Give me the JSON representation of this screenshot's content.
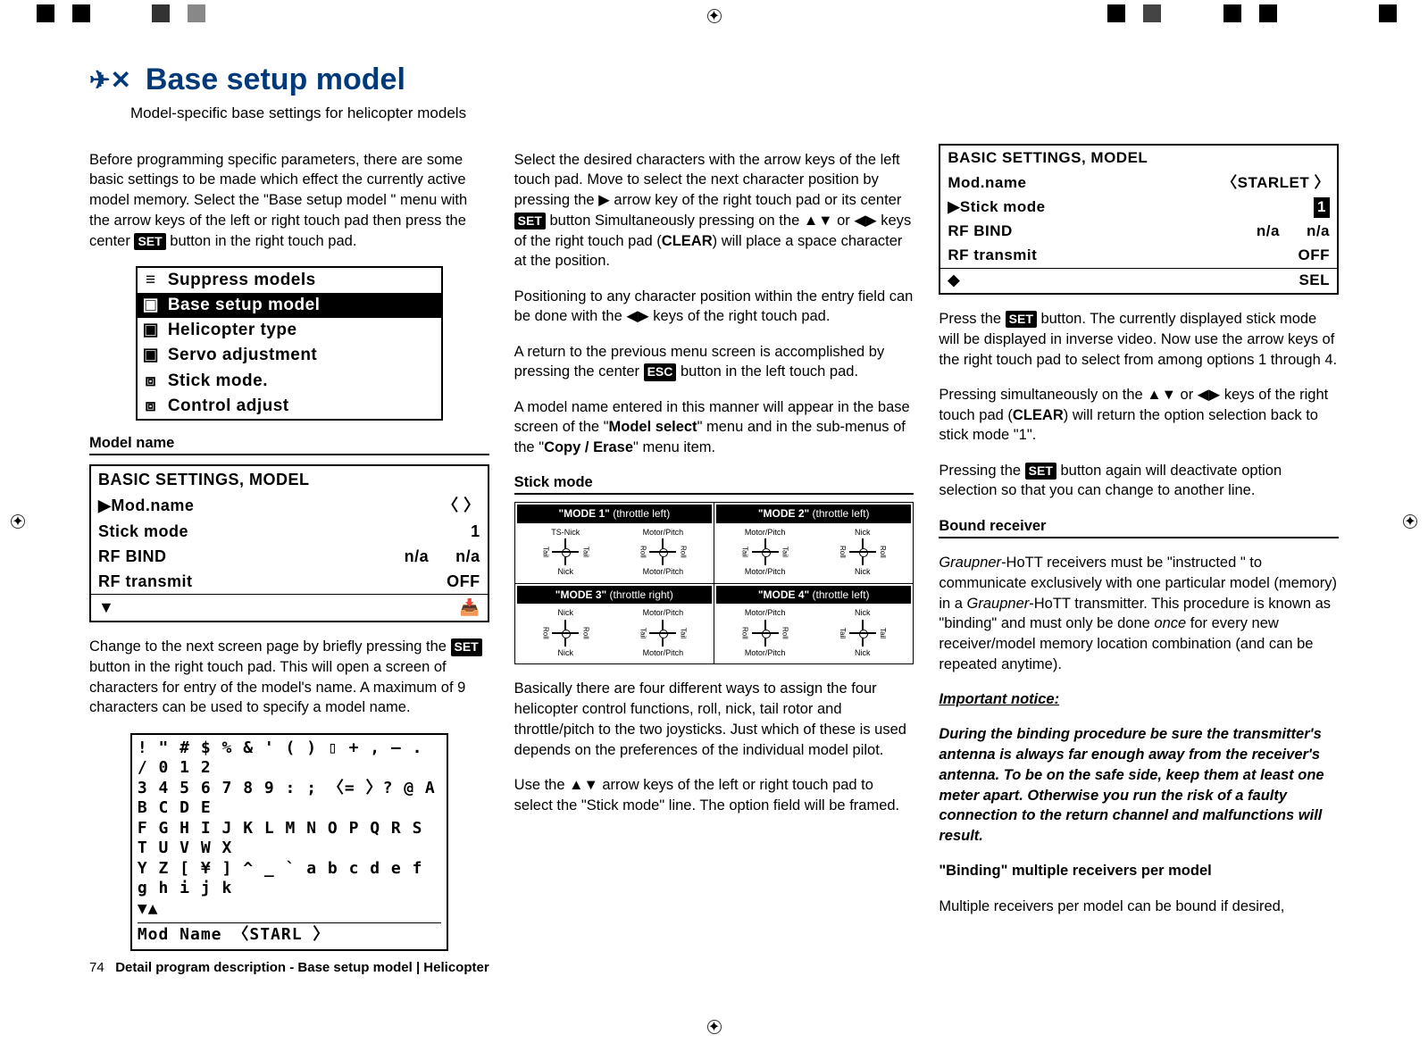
{
  "header": {
    "title": "Base setup model",
    "subtitle": "Model-specific base settings for helicopter models"
  },
  "col1": {
    "p1a": "Before programming specific parameters, there are some basic settings to be made which effect the currently active model memory. Select the \"Base setup model \" menu with the arrow keys of the left or right touch pad then press the center ",
    "p1b": " button in the right touch pad.",
    "menu": {
      "i1": "Suppress models",
      "i2": "Base setup model",
      "i3": "Helicopter type",
      "i4": "Servo adjustment",
      "i5": "Stick mode.",
      "i6": "Control adjust"
    },
    "sect1": "Model name",
    "screen1": {
      "hdr": "BASIC  SETTINGS,  MODEL",
      "r1": "▶Mod.name",
      "r1v": "〈                  〉",
      "r2": "  Stick mode",
      "r2v": "1",
      "r3": "  RF BIND",
      "r3a": "n/a",
      "r3b": "n/a",
      "r4": "  RF transmit",
      "r4v": "OFF",
      "foot": "▼",
      "footicon": "📥"
    },
    "p2a": "Change to the next screen page by briefly pressing the ",
    "p2b": " button in the right touch pad. This will open a screen of characters for entry of the model's name. A maximum of 9 characters can be used to specify a model name.",
    "chars": {
      "l1": " ! \" # $ % & ' ( ) ▯ + , – . / 0 1 2",
      "l2": "3 4 5 6 7 8 9 : ; 〈= 〉? @ A B C D E",
      "l3": "F G H I J K L M N O P Q R S T U V W X",
      "l4": "Y Z [ ¥ ] ^ _ ` a b c d e f g h i j k",
      "l5": "▼▲",
      "ftr": "Mod  Name 〈STARL          〉"
    }
  },
  "col2": {
    "p1a": "Select the desired characters with the arrow keys of the left touch pad. Move to select the next character position by pressing the ▶ arrow key of the right touch pad or its center ",
    "p1b": " button Simultaneously pressing on the ▲▼ or ◀▶ keys of the right touch pad (",
    "p1c": ") will place a space character at the position.",
    "clear": "CLEAR",
    "p2": "Positioning to any character position within the entry field can be done with the ◀▶ keys of the right touch pad.",
    "p3a": "A return to the previous menu screen is accomplished by pressing the center ",
    "p3b": " button in the left touch pad.",
    "p4a": "A model name entered in this manner will appear in the base screen of the \"",
    "p4m": "Model select",
    "p4b": "\" menu and in the sub-menus of the \"",
    "p4n": "Copy / Erase",
    "p4c": "\" menu item.",
    "sect2": "Stick mode",
    "modes": {
      "m1": "\"MODE 1\"",
      "m1t": " (throttle left)",
      "m2": "\"MODE 2\"",
      "m2t": " (throttle left)",
      "m3": "\"MODE 3\"",
      "m3t": " (throttle right)",
      "m4": "\"MODE 4\"",
      "m4t": " (throttle left)",
      "tsnick": "TS-Nick",
      "nick": "Nick",
      "mp": "Motor/Pitch",
      "roll": "Roll",
      "tail": "Tail"
    },
    "p5": "Basically there are four different ways to assign the four helicopter control functions, roll, nick, tail rotor and throttle/pitch to the two joysticks. Just which of these is used depends on the preferences of the individual model pilot.",
    "p6": "Use the ▲▼ arrow keys of the left or right touch pad to select the \"Stick mode\" line. The option field will be framed."
  },
  "col3": {
    "screen2": {
      "hdr": "BASIC  SETTINGS,  MODEL",
      "r1": "  Mod.name",
      "r1v": "〈STARLET   〉",
      "r2": "▶Stick mode",
      "r2v": "1",
      "r3": "  RF BIND",
      "r3a": "n/a",
      "r3b": "n/a",
      "r4": "  RF transmit",
      "r4v": "OFF",
      "foot": "◆",
      "footv": "SEL"
    },
    "p1a": "Press the ",
    "p1b": " button. The currently displayed stick mode will be displayed in inverse video. Now use the arrow keys of the right touch pad to select from among options 1 through 4.",
    "p2a": "Pressing simultaneously on the ▲▼ or ◀▶ keys of the right touch pad (",
    "p2b": ") will return the option selection back to stick mode \"1\".",
    "clear": "CLEAR",
    "p3a": "Pressing the ",
    "p3b": " button again will deactivate option selection so that you can change to another line.",
    "sect3": "Bound receiver",
    "p4a": "Graupner",
    "p4b": "-HoTT receivers must be \"instructed \" to communicate exclusively with one particular model (memory) in a ",
    "p4c": "Graupner",
    "p4d": "-HoTT transmitter. This procedure is known as \"binding\" and must only be done ",
    "p4e": "once",
    "p4f": " for every new receiver/model memory location combination (and can be repeated anytime).",
    "notice_h": "Important notice:",
    "notice": "During the binding procedure be sure the transmitter's antenna is always far enough away from the receiver's antenna. To be on the safe side, keep them at least one meter apart. Otherwise you run the risk of a faulty connection to the return channel and malfunctions will result.",
    "bind_h": "\"Binding\" multiple receivers per model",
    "p5": "Multiple receivers per model can be bound if desired,"
  },
  "btns": {
    "set": "SET",
    "esc": "ESC"
  },
  "footer": {
    "pg": "74",
    "txt": "Detail program description - Base setup model | Helicopter"
  }
}
